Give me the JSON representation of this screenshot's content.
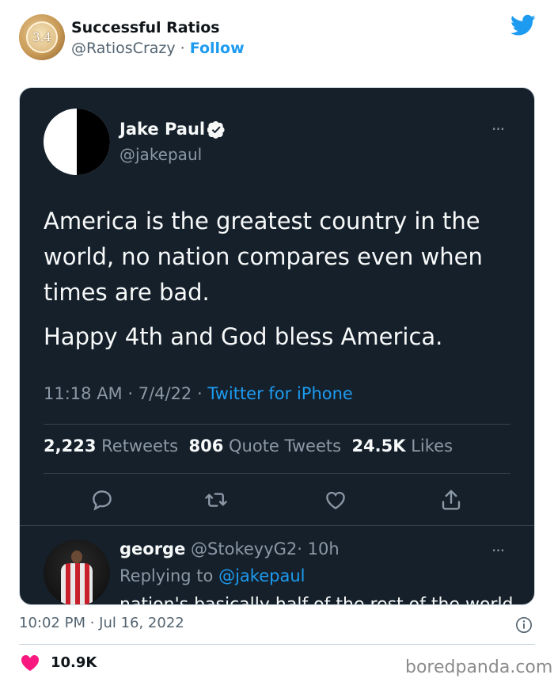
{
  "embed": {
    "account_name": "Successful Ratios",
    "account_handle": "@RatiosCrazy",
    "separator": "·",
    "follow_label": "Follow",
    "avatar_text": "3.4",
    "timestamp": "10:02 PM · Jul 16, 2022",
    "likes_count": "10.9K",
    "heart_color": "#f91880"
  },
  "tweet": {
    "author_name": "Jake Paul",
    "author_handle": "@jakepaul",
    "paragraphs": [
      "America is the greatest country in the world, no nation compares even when times are bad.",
      "Happy 4th and God bless America."
    ],
    "time": "11:18 AM · 7/4/22 ·",
    "source": "Twitter for iPhone",
    "stats": {
      "retweets_value": "2,223",
      "retweets_label": "Retweets",
      "quotes_value": "806",
      "quotes_label": "Quote Tweets",
      "likes_value": "24.5K",
      "likes_label": "Likes"
    },
    "more_label": "···"
  },
  "reply": {
    "name": "george",
    "handle": "@StokeyyG2",
    "age": "· 10h",
    "replying_to_label": "Replying to",
    "replying_to_handle": "@jakepaul",
    "cut_text": "nation's basically half of the rest of the world"
  },
  "watermark": "boredpanda.com",
  "colors": {
    "twitter_blue": "#1d9bf0",
    "card_background": "#15202b"
  }
}
